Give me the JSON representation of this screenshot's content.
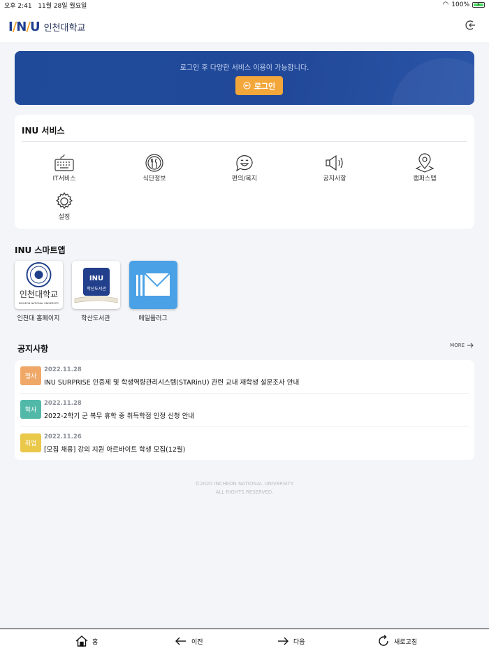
{
  "status": {
    "time": "오후 2:41",
    "date": "11월 28일 월요일",
    "battery": "100%"
  },
  "header": {
    "logo_mark": "INU",
    "logo_name": "인천대학교"
  },
  "banner": {
    "message": "로그인 후 다양한 서비스 이용이 가능합니다.",
    "login_label": "로그인"
  },
  "services": {
    "title": "INU 서비스",
    "items": [
      {
        "label": "IT서비스",
        "icon": "keyboard-icon"
      },
      {
        "label": "식단정보",
        "icon": "utensils-icon"
      },
      {
        "label": "편의/복지",
        "icon": "smile-chat-icon"
      },
      {
        "label": "공지사항",
        "icon": "megaphone-icon"
      },
      {
        "label": "캠퍼스맵",
        "icon": "map-pin-icon"
      },
      {
        "label": "설정",
        "icon": "gear-icon"
      }
    ]
  },
  "smartapps": {
    "title": "INU 스마트앱",
    "items": [
      {
        "label": "인천대 홈페이지",
        "tile_text": "인천대학교",
        "tile_sub": "INCHEON NATIONAL UNIVERSITY"
      },
      {
        "label": "학산도서관",
        "tile_text": "학산도서관"
      },
      {
        "label": "메일플러그"
      }
    ]
  },
  "notices": {
    "title": "공지사항",
    "more_label": "MORE",
    "items": [
      {
        "tag": "행사",
        "tag_color": "#f0a868",
        "date": "2022.11.28",
        "title": "INU SURPRISE 인증제 및 학생역량관리시스템(STARinU) 관련 교내 재학생 설문조사 안내"
      },
      {
        "tag": "학사",
        "tag_color": "#52b9a8",
        "date": "2022.11.28",
        "title": "2022-2학기 군 복무 휴학 중 취득학점 인정 신청 안내"
      },
      {
        "tag": "취업",
        "tag_color": "#eac84a",
        "date": "2022.11.26",
        "title": "[모집 채용] 강의 지원 아르바이트 학생 모집(12월)"
      }
    ]
  },
  "footer": {
    "line1": "©2020 INCHEON NATIONAL UNIVERSITY.",
    "line2": "ALL RIGHTS RESERVED."
  },
  "bottom_nav": {
    "home": "홈",
    "prev": "이전",
    "next": "다음",
    "refresh": "새로고침"
  },
  "colors": {
    "brand_blue": "#1f4a9a",
    "accent_orange": "#f3a73a"
  }
}
